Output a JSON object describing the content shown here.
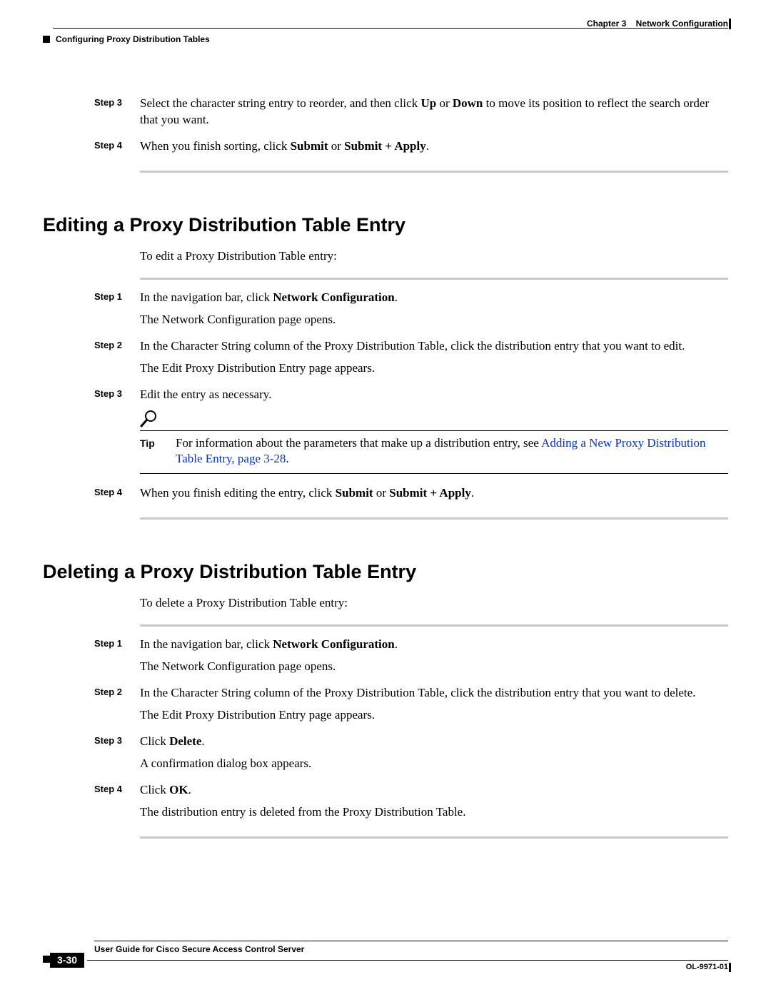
{
  "header": {
    "chapter_label": "Chapter 3",
    "chapter_title": "Network Configuration",
    "section_title": "Configuring Proxy Distribution Tables"
  },
  "top_steps": {
    "step3": {
      "label": "Step 3",
      "text_pre": "Select the character string entry to reorder, and then click ",
      "bold1": "Up",
      "text_mid": " or ",
      "bold2": "Down",
      "text_post": " to move its position to reflect the search order that you want."
    },
    "step4": {
      "label": "Step 4",
      "text_pre": "When you finish sorting, click ",
      "bold1": "Submit",
      "text_mid": " or ",
      "bold2": "Submit + Apply",
      "text_post": "."
    }
  },
  "section_edit": {
    "heading": "Editing a Proxy Distribution Table Entry",
    "intro": "To edit a Proxy Distribution Table entry:",
    "step1": {
      "label": "Step 1",
      "line1_pre": "In the navigation bar, click ",
      "line1_bold": "Network Configuration",
      "line1_post": ".",
      "line2": "The Network Configuration page opens."
    },
    "step2": {
      "label": "Step 2",
      "line1": "In the Character String column of the Proxy Distribution Table, click the distribution entry that you want to edit.",
      "line2": "The Edit Proxy Distribution Entry page appears."
    },
    "step3": {
      "label": "Step 3",
      "line1": "Edit the entry as necessary.",
      "tip_label": "Tip",
      "tip_pre": "For information about the parameters that make up a distribution entry, see ",
      "tip_link": "Adding a New Proxy Distribution Table Entry, page 3-28",
      "tip_post": "."
    },
    "step4": {
      "label": "Step 4",
      "text_pre": "When you finish editing the entry, click ",
      "bold1": "Submit",
      "text_mid": " or ",
      "bold2": "Submit + Apply",
      "text_post": "."
    }
  },
  "section_delete": {
    "heading": "Deleting a Proxy Distribution Table Entry",
    "intro": "To delete a Proxy Distribution Table entry:",
    "step1": {
      "label": "Step 1",
      "line1_pre": "In the navigation bar, click ",
      "line1_bold": "Network Configuration",
      "line1_post": ".",
      "line2": "The Network Configuration page opens."
    },
    "step2": {
      "label": "Step 2",
      "line1": "In the Character String column of the Proxy Distribution Table, click the distribution entry that you want to delete.",
      "line2": "The Edit Proxy Distribution Entry page appears."
    },
    "step3": {
      "label": "Step 3",
      "line1_pre": "Click ",
      "line1_bold": "Delete",
      "line1_post": ".",
      "line2": "A confirmation dialog box appears."
    },
    "step4": {
      "label": "Step 4",
      "line1_pre": "Click ",
      "line1_bold": "OK",
      "line1_post": ".",
      "line2": "The distribution entry is deleted from the Proxy Distribution Table."
    }
  },
  "footer": {
    "guide_title": "User Guide for Cisco Secure Access Control Server",
    "page_number": "3-30",
    "doc_id": "OL-9971-01"
  }
}
